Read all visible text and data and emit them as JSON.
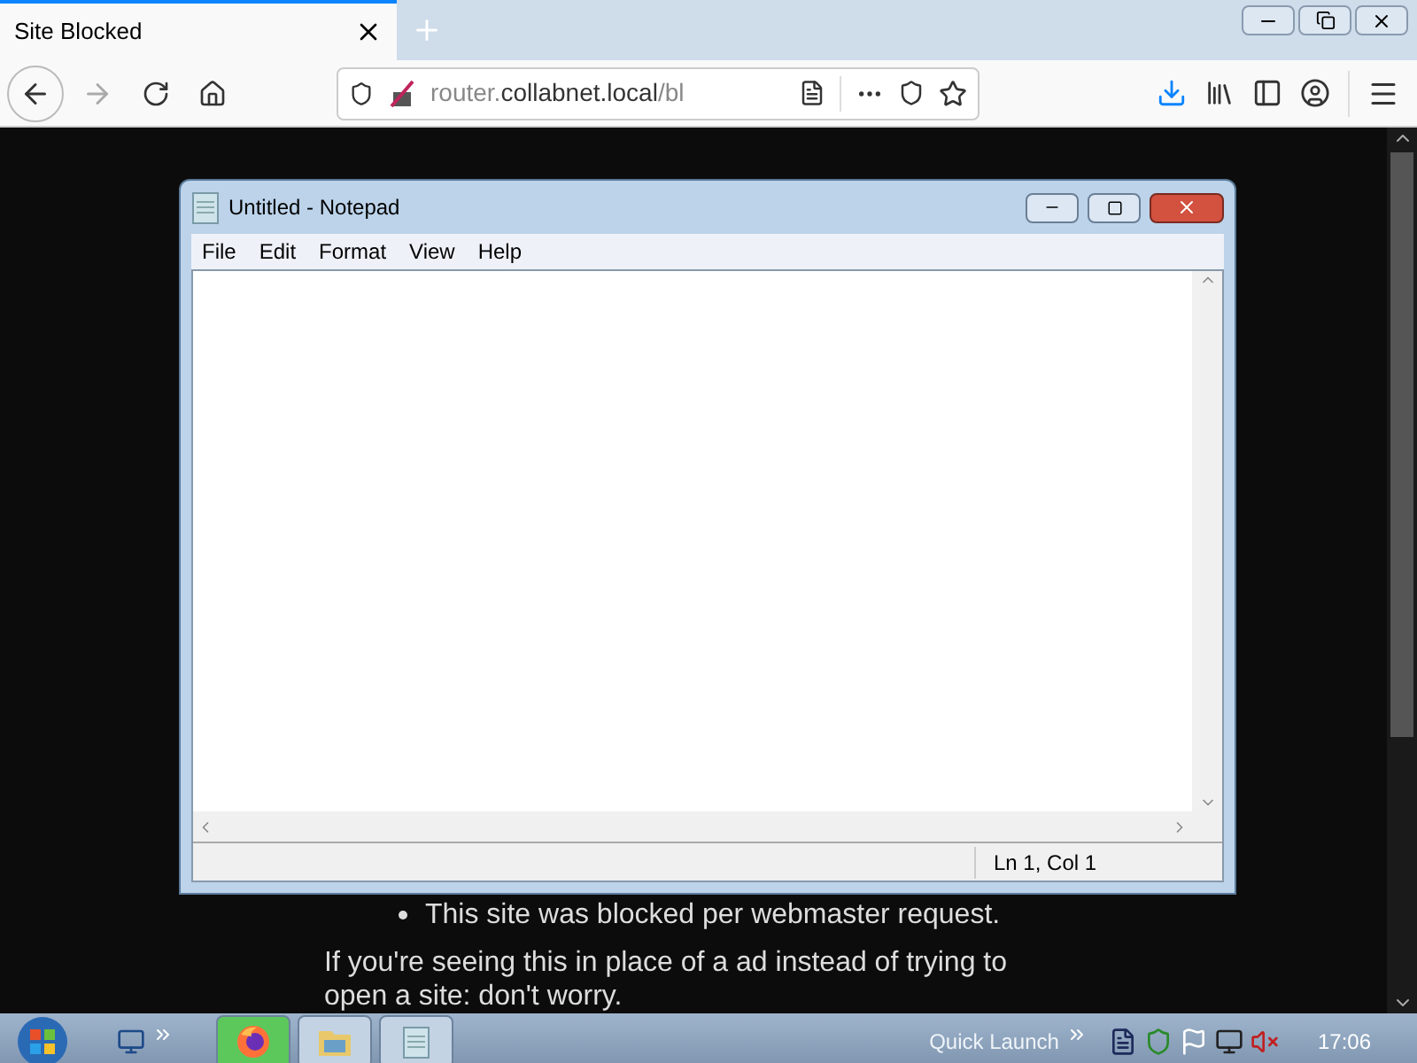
{
  "browser": {
    "tabs": [
      {
        "title": "Site Blocked",
        "selected": true
      }
    ],
    "address": {
      "host_prefix": "router.",
      "host": "collabnet.local",
      "path": "/bl"
    }
  },
  "page": {
    "bullets": [
      "This site was blocked per webmaster request."
    ],
    "paragraph": "If you're seeing this in place of a ad instead of trying to open a site: don't worry."
  },
  "notepad": {
    "title": "Untitled - Notepad",
    "menu": [
      "File",
      "Edit",
      "Format",
      "View",
      "Help"
    ],
    "status": "Ln 1, Col 1"
  },
  "taskbar": {
    "buttons": [
      {
        "kind": "firefox",
        "selected": true
      },
      {
        "kind": "explorer",
        "selected": false
      },
      {
        "kind": "notepad",
        "selected": false
      }
    ],
    "quick_launch": "Quick Launch",
    "clock": "17:06"
  }
}
